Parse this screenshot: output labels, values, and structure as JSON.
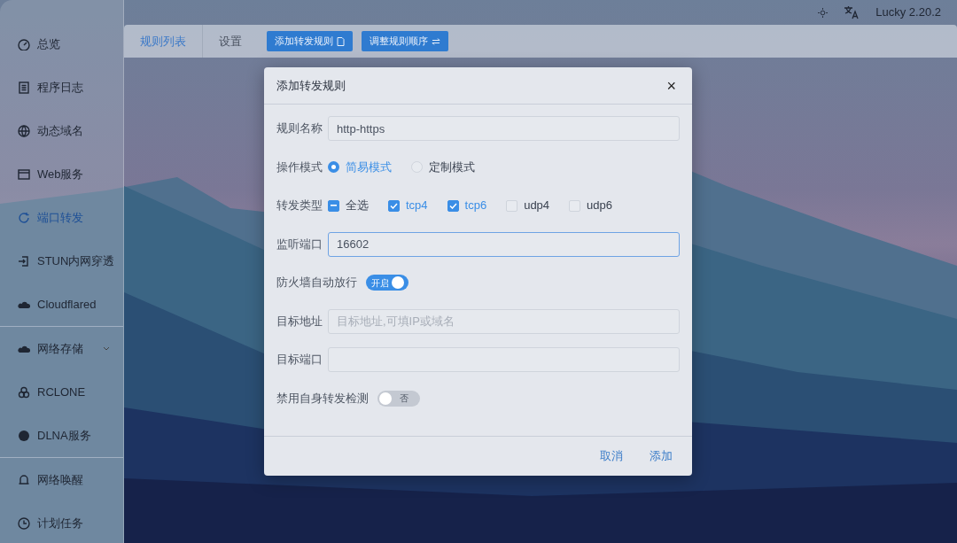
{
  "topbar": {
    "version": "Lucky 2.20.2"
  },
  "sidebar": {
    "groups": [
      [
        {
          "label": "总览",
          "selected": false
        },
        {
          "label": "程序日志",
          "selected": false
        },
        {
          "label": "动态域名",
          "selected": false
        },
        {
          "label": "Web服务",
          "selected": false
        },
        {
          "label": "端口转发",
          "selected": true
        },
        {
          "label": "STUN内网穿透",
          "selected": false
        },
        {
          "label": "Cloudflared",
          "selected": false
        }
      ],
      [
        {
          "label": "网络存储",
          "selected": false,
          "expandable": true
        },
        {
          "label": "RCLONE",
          "selected": false
        },
        {
          "label": "DLNA服务",
          "selected": false
        }
      ],
      [
        {
          "label": "网络唤醒",
          "selected": false
        },
        {
          "label": "计划任务",
          "selected": false
        }
      ]
    ]
  },
  "tabs": [
    {
      "label": "规则列表",
      "selected": true
    },
    {
      "label": "设置",
      "selected": false
    }
  ],
  "actions": [
    "添加转发规则",
    "调整规则顺序"
  ],
  "dialog": {
    "title": "添加转发规则",
    "close": "×",
    "fields": [
      {
        "kind": "text",
        "label": "规则名称",
        "value": "http-https",
        "focused": false
      },
      {
        "kind": "radio",
        "label": "操作模式",
        "options": [
          {
            "label": "简易模式",
            "selected": true
          },
          {
            "label": "定制模式",
            "selected": false
          }
        ]
      },
      {
        "kind": "checkbox",
        "label": "转发类型",
        "options": [
          {
            "label": "全选",
            "checked": false,
            "indeterminate": true
          },
          {
            "label": "tcp4",
            "checked": true
          },
          {
            "label": "tcp6",
            "checked": true
          },
          {
            "label": "udp4",
            "checked": false
          },
          {
            "label": "udp6",
            "checked": false
          }
        ]
      },
      {
        "kind": "text",
        "label": "监听端口",
        "value": "16602",
        "focused": true
      },
      {
        "kind": "switch",
        "label": "防火墙自动放行",
        "on": true,
        "text": "开启"
      },
      {
        "kind": "text",
        "label": "目标地址",
        "placeholder": "目标地址,可填IP或域名",
        "focused": false
      },
      {
        "kind": "text",
        "label": "目标端口",
        "focused": false
      },
      {
        "kind": "switch",
        "label": "禁用自身转发检测",
        "on": false,
        "text": "否"
      }
    ],
    "buttons": [
      "取消",
      "添加"
    ]
  }
}
